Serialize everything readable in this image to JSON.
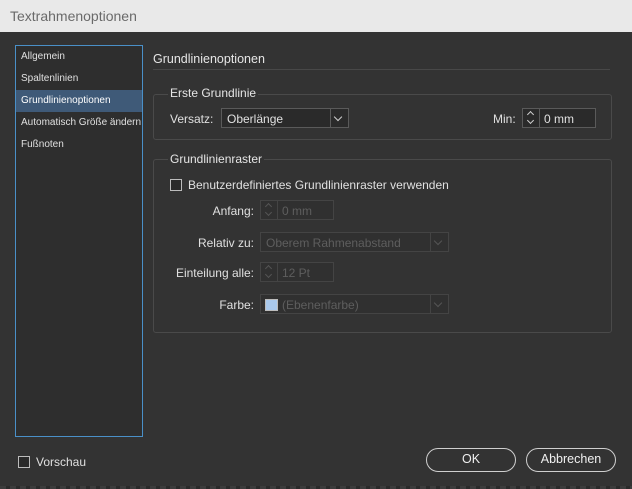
{
  "window": {
    "title": "Textrahmenoptionen"
  },
  "sidebar": {
    "items": [
      {
        "label": "Allgemein"
      },
      {
        "label": "Spaltenlinien"
      },
      {
        "label": "Grundlinienoptionen"
      },
      {
        "label": "Automatisch Größe ändern"
      },
      {
        "label": "Fußnoten"
      }
    ],
    "selected": "Grundlinienoptionen"
  },
  "main": {
    "title": "Grundlinienoptionen"
  },
  "first_baseline": {
    "group_title": "Erste Grundlinie",
    "offset_label": "Versatz:",
    "offset_value": "Oberlänge",
    "min_label": "Min:",
    "min_value": "0 mm"
  },
  "grid": {
    "group_title": "Grundlinienraster",
    "custom_checkbox_label": "Benutzerdefiniertes Grundlinienraster verwenden",
    "custom_checked": false,
    "start_label": "Anfang:",
    "start_value": "0 mm",
    "relative_label": "Relativ zu:",
    "relative_value": "Oberem Rahmenabstand",
    "increment_label": "Einteilung alle:",
    "increment_value": "12 Pt",
    "color_label": "Farbe:",
    "color_value": "(Ebenenfarbe)",
    "swatch_color": "#a9c8ec"
  },
  "footer": {
    "preview_label": "Vorschau",
    "preview_checked": false,
    "ok_label": "OK",
    "cancel_label": "Abbrechen"
  }
}
